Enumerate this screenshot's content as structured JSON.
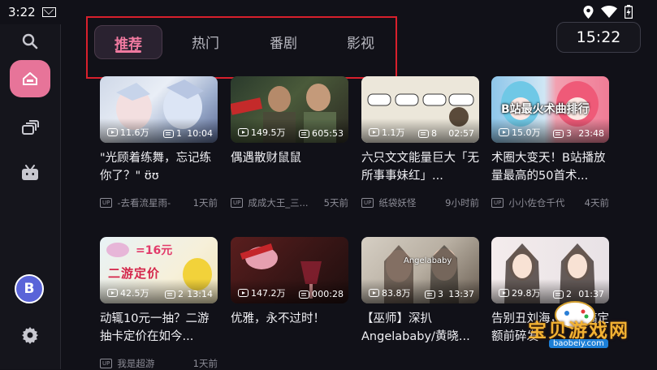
{
  "status_bar": {
    "time": "3:22"
  },
  "tabs": [
    {
      "label": "推荐",
      "active": true
    },
    {
      "label": "热门",
      "active": false
    },
    {
      "label": "番剧",
      "active": false
    },
    {
      "label": "影视",
      "active": false
    }
  ],
  "clock": "15:22",
  "sidebar": {
    "avatar_letter": "B"
  },
  "videos": [
    {
      "views": "11.6万",
      "danmaku": "1",
      "duration": "10:04",
      "title": "\"光顾着练舞，忘记练你了？\" ʊ̈ʊ",
      "author": "-去看流星雨-",
      "time": "1天前"
    },
    {
      "views": "149.5万",
      "danmaku": "6",
      "duration": "05:53",
      "title": "偶遇散财鼠鼠",
      "author": "成成大王_三...",
      "time": "5天前"
    },
    {
      "views": "1.1万",
      "danmaku": "8",
      "duration": "02:57",
      "title": "六只文文能量巨大「无所事事妹红」...",
      "author": "纸袋妖怪",
      "time": "9小时前"
    },
    {
      "views": "15.0万",
      "danmaku": "3",
      "duration": "23:48",
      "title": "术圈大变天！B站播放量最高的50首术...",
      "author": "小小佐仓千代",
      "time": "4天前"
    },
    {
      "views": "42.5万",
      "danmaku": "2",
      "duration": "13:14",
      "title": "动辄10元一抽？二游抽卡定价在如今...",
      "author": "我是超游",
      "time": "1天前"
    },
    {
      "views": "147.2万",
      "danmaku": "0",
      "duration": "00:28",
      "title": "优雅，永不过时！",
      "author": "",
      "time": ""
    },
    {
      "views": "83.8万",
      "danmaku": "3",
      "duration": "13:37",
      "title": "【巫师】深扒Angelababy/黄晓...",
      "author": "",
      "time": ""
    },
    {
      "views": "29.8万",
      "danmaku": "2",
      "duration": "01:37",
      "title": "告别丑刘海，一招搞定额前碎发",
      "author": "",
      "time": ""
    }
  ],
  "thumbnail_overlays": {
    "v5_caption": "=16元",
    "v5_subtitle": "二游定价",
    "v7_caption": "Angelababy",
    "v4_caption": "B站最火术曲排行"
  },
  "watermark": {
    "text": "宝贝游戏网",
    "url": "baobeiy.com"
  },
  "colors": {
    "accent": "#f07aa0",
    "home_button": "#e77499",
    "highlight_box": "#d8202c",
    "avatar": "#5a64d8",
    "background": "#111118"
  }
}
